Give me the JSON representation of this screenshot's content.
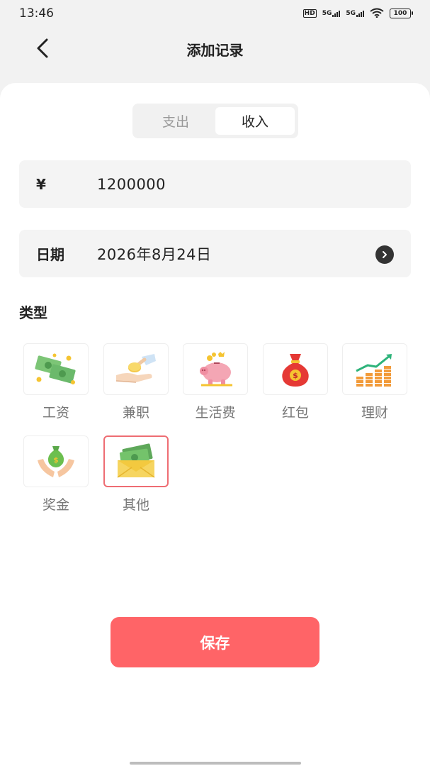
{
  "status_bar": {
    "time": "13:46",
    "hd_label": "HD",
    "net1": "5G",
    "net2": "5G",
    "battery": "100"
  },
  "header": {
    "title": "添加记录",
    "back_icon": "chevron-left-icon"
  },
  "tabs": [
    {
      "label": "支出",
      "active": false
    },
    {
      "label": "收入",
      "active": true
    }
  ],
  "amount": {
    "symbol": "¥",
    "value": "1200000"
  },
  "date": {
    "label": "日期",
    "value": "2026年8月24日",
    "icon": "chevron-right-circle-icon"
  },
  "type_section": {
    "title": "类型",
    "items": [
      {
        "label": "工资",
        "icon": "cash-money-icon",
        "selected": false
      },
      {
        "label": "兼职",
        "icon": "hand-coin-icon",
        "selected": false
      },
      {
        "label": "生活费",
        "icon": "piggy-bank-icon",
        "selected": false
      },
      {
        "label": "红包",
        "icon": "red-money-bag-icon",
        "selected": false
      },
      {
        "label": "理财",
        "icon": "investment-growth-icon",
        "selected": false
      },
      {
        "label": "奖金",
        "icon": "hands-money-bag-icon",
        "selected": false
      },
      {
        "label": "其他",
        "icon": "money-envelope-icon",
        "selected": true
      }
    ]
  },
  "save_button": {
    "label": "保存"
  },
  "colors": {
    "accent": "#ff6467",
    "selected_border": "#ee6d73",
    "background": "#f2f2f2"
  }
}
